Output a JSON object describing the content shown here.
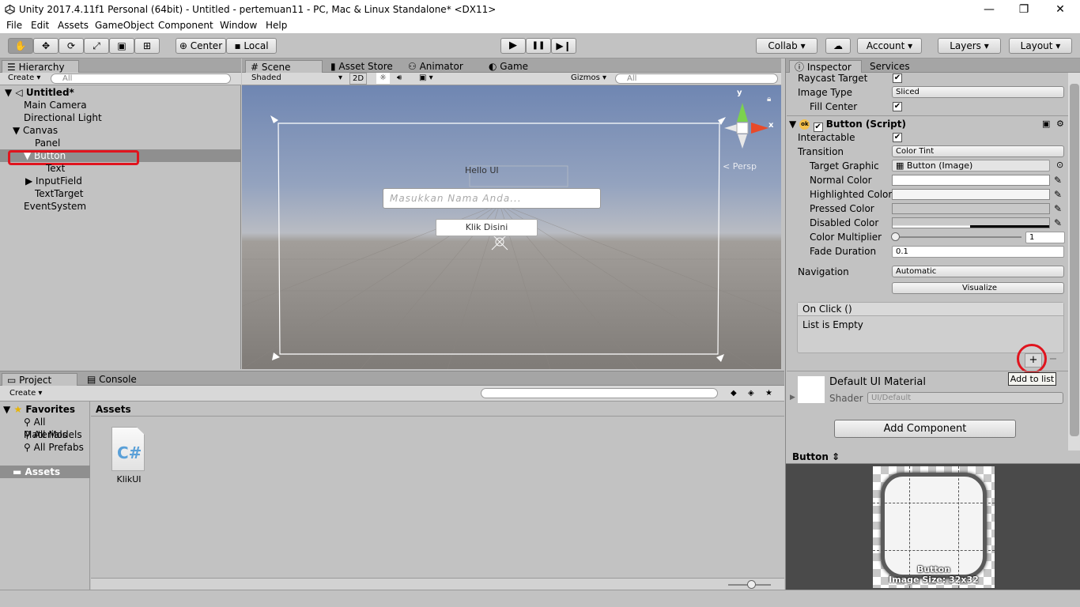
{
  "window": {
    "title": "Unity 2017.4.11f1 Personal (64bit) - Untitled - pertemuan11 - PC, Mac & Linux Standalone* <DX11>",
    "minimize": "—",
    "restore": "❐",
    "close": "✕"
  },
  "menu": [
    "File",
    "Edit",
    "Assets",
    "GameObject",
    "Component",
    "Window",
    "Help"
  ],
  "toolbar": {
    "center": "Center",
    "local": "Local",
    "collab": "Collab",
    "account": "Account",
    "layers": "Layers",
    "layout": "Layout",
    "play": "▶",
    "pause": "❚❚",
    "step": "▶❙"
  },
  "hierarchy": {
    "tab": "Hierarchy",
    "create": "Create",
    "search_placeholder": "All",
    "scene": "Untitled*",
    "items": [
      "Main Camera",
      "Directional Light",
      "Canvas",
      "Panel",
      "Button",
      "Text",
      "InputField",
      "TextTarget",
      "EventSystem"
    ]
  },
  "scene": {
    "tabs": [
      "Scene",
      "Asset Store",
      "Animator",
      "Game"
    ],
    "shading": "Shaded",
    "mode2d": "2D",
    "gizmos": "Gizmos",
    "search_placeholder": "All",
    "persp": "Persp",
    "axis_x": "x",
    "axis_y": "y",
    "hello": "Hello UI",
    "input_placeholder": "Masukkan Nama Anda...",
    "button": "Klik Disini"
  },
  "inspector": {
    "tabs": [
      "Inspector",
      "Services"
    ],
    "raycast_target": "Raycast Target",
    "image_type": "Image Type",
    "image_type_value": "Sliced",
    "fill_center": "Fill Center",
    "component": "Button (Script)",
    "interactable": "Interactable",
    "transition": "Transition",
    "transition_value": "Color Tint",
    "target_graphic": "Target Graphic",
    "target_graphic_value": "Button (Image)",
    "normal_color": "Normal Color",
    "highlighted_color": "Highlighted Color",
    "pressed_color": "Pressed Color",
    "disabled_color": "Disabled Color",
    "color_multiplier": "Color Multiplier",
    "color_multiplier_value": "1",
    "fade_duration": "Fade Duration",
    "fade_duration_value": "0.1",
    "navigation": "Navigation",
    "navigation_value": "Automatic",
    "visualize": "Visualize",
    "onclick": "On Click ()",
    "list_empty": "List is Empty",
    "plus": "+",
    "minus": "−",
    "tooltip": "Add to list",
    "material": "Default UI Material",
    "shader": "Shader",
    "shader_value": "UI/Default",
    "add_component": "Add Component"
  },
  "preview": {
    "title": "Button",
    "label": "Button",
    "size": "Image Size: 32x32"
  },
  "project": {
    "tabs": [
      "Project",
      "Console"
    ],
    "create": "Create",
    "favorites": "Favorites",
    "fav_items": [
      "All Materials",
      "All Models",
      "All Prefabs"
    ],
    "assets": "Assets",
    "header": "Assets",
    "file": "KlikUI",
    "file_icon": "C#"
  },
  "colors": {
    "highlight_red": "#e0141e",
    "selection": "#8f8f8f",
    "sky": "#7d93b9"
  }
}
